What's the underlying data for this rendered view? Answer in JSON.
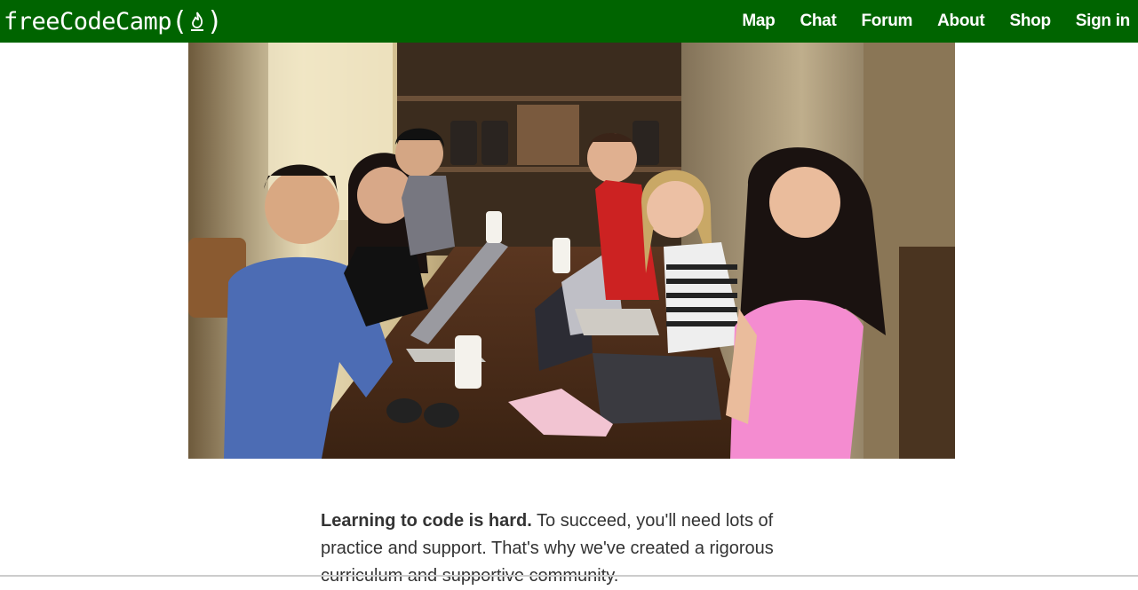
{
  "navbar": {
    "brand_text": "freeCodeCamp",
    "brand_open_paren": "(",
    "brand_close_paren": ")",
    "brand_icon": "flame-icon",
    "links": [
      {
        "label": "Map"
      },
      {
        "label": "Chat"
      },
      {
        "label": "Forum"
      },
      {
        "label": "About"
      },
      {
        "label": "Shop"
      },
      {
        "label": "Sign in"
      }
    ]
  },
  "hero": {
    "subject": "group of campers with laptops at a cafe table"
  },
  "intro": {
    "bold": "Learning to code is hard.",
    "rest": " To succeed, you'll need lots of practice and support. That's why we've created a rigorous curriculum and supportive community."
  },
  "colors": {
    "navbar_bg": "#006400",
    "nav_text": "#ffffff",
    "body_text": "#333333"
  }
}
